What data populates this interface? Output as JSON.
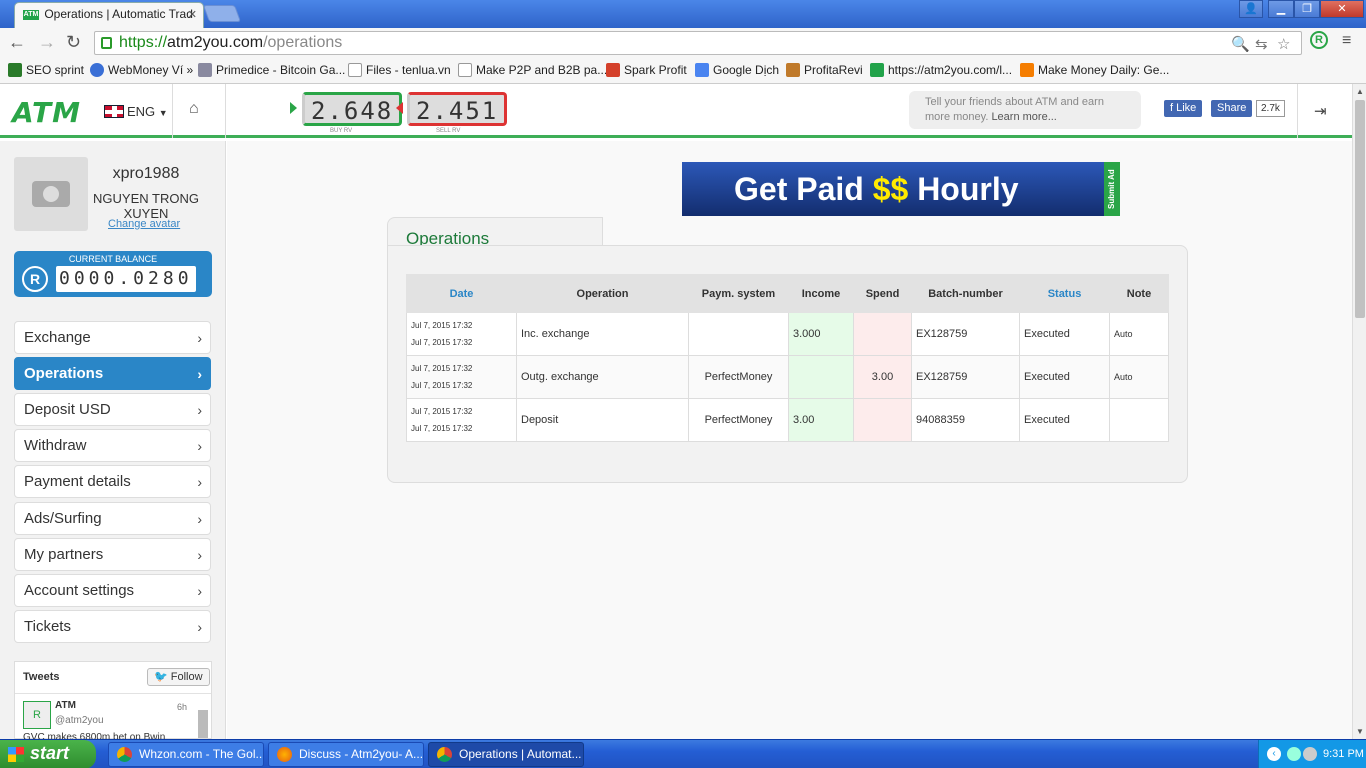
{
  "browser": {
    "tab_title": "Operations | Automatic Trad",
    "tab_favicon": "ATM",
    "url_scheme": "https://",
    "url_host": "atm2you.com",
    "url_path": "/operations",
    "bookmarks": [
      "SEO sprint",
      "WebMoney Ví »",
      "Primedice - Bitcoin Ga...",
      "Files - tenlua.vn",
      "Make P2P and B2B pa...",
      "Spark Profit",
      "Google Dịch",
      "ProfitaRevi",
      "https://atm2you.com/l...",
      "Make Money Daily: Ge..."
    ]
  },
  "header": {
    "logo": "ATM",
    "lang": "ENG",
    "buy_rate": "2.648",
    "buy_caption": "BUY RV",
    "sell_rate": "2.451",
    "sell_caption": "SELL RV",
    "tell_text": "Tell your friends about ATM and earn more money.",
    "learn_more": "Learn more...",
    "fb_like": "Like",
    "fb_share": "Share",
    "fb_count": "2.7k"
  },
  "user": {
    "username": "xpro1988",
    "full_name": "NGUYEN TRONG XUYEN",
    "change_avatar": "Change avatar",
    "balance_label": "CURRENT BALANCE",
    "balance_digits": "0000.0280",
    "balance_icon": "R"
  },
  "menu": [
    "Exchange",
    "Operations",
    "Deposit USD",
    "Withdraw",
    "Payment details",
    "Ads/Surfing",
    "My partners",
    "Account settings",
    "Tickets"
  ],
  "tweets": {
    "title": "Tweets",
    "follow": "Follow",
    "author": "ATM",
    "handle": "@atm2you",
    "time": "6h",
    "text": "GVC makes 6800m bet on Bwin"
  },
  "banner": {
    "part1": "Get Paid ",
    "part2": "$$",
    "part3": " Hourly",
    "side": "Submit Ad"
  },
  "operations": {
    "title": "Operations",
    "headers": {
      "date": "Date",
      "operation": "Operation",
      "paym": "Paym. system",
      "income": "Income",
      "spend": "Spend",
      "batch": "Batch-number",
      "status": "Status",
      "note": "Note"
    },
    "rows": [
      {
        "date1": "Jul 7, 2015 17:32",
        "date2": "Jul 7, 2015 17:32",
        "operation": "Inc. exchange",
        "paym": "",
        "income": "3.000",
        "spend": "",
        "batch": "EX128759",
        "status": "Executed",
        "note": "Auto"
      },
      {
        "date1": "Jul 7, 2015 17:32",
        "date2": "Jul 7, 2015 17:32",
        "operation": "Outg. exchange",
        "paym": "PerfectMoney",
        "income": "",
        "spend": "3.00",
        "batch": "EX128759",
        "status": "Executed",
        "note": "Auto"
      },
      {
        "date1": "Jul 7, 2015 17:32",
        "date2": "Jul 7, 2015 17:32",
        "operation": "Deposit",
        "paym": "PerfectMoney",
        "income": "3.00",
        "spend": "",
        "batch": "94088359",
        "status": "Executed",
        "note": ""
      }
    ]
  },
  "taskbar": {
    "start": "start",
    "tasks": [
      "Whzon.com - The Gol...",
      "Discuss - Atm2you- A...",
      "Operations | Automat..."
    ],
    "clock": "9:31 PM"
  }
}
